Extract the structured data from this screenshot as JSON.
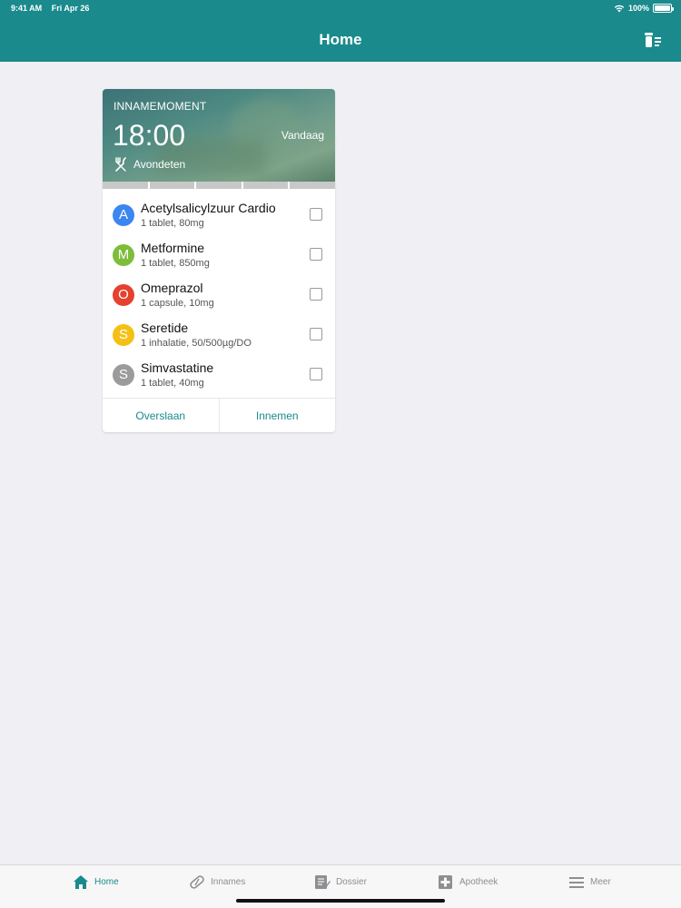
{
  "status_bar": {
    "time": "9:41 AM",
    "date": "Fri Apr 26",
    "battery": "100%"
  },
  "nav": {
    "title": "Home",
    "action_icon": "medicine-list-icon"
  },
  "card": {
    "moment_label": "INNAMEMOMENT",
    "time": "18:00",
    "day": "Vandaag",
    "meal": "Avondeten",
    "meal_icon": "fork-knife-icon",
    "medications": [
      {
        "initial": "A",
        "name": "Acetylsalicylzuur Cardio",
        "dose": "1 tablet, 80mg",
        "color": "#3b86f0",
        "checked": false
      },
      {
        "initial": "M",
        "name": "Metformine",
        "dose": "1 tablet, 850mg",
        "color": "#7cbd3a",
        "checked": false
      },
      {
        "initial": "O",
        "name": "Omeprazol",
        "dose": "1 capsule, 10mg",
        "color": "#e5412f",
        "checked": false
      },
      {
        "initial": "S",
        "name": "Seretide",
        "dose": "1 inhalatie, 50/500µg/DO",
        "color": "#f4c016",
        "checked": false
      },
      {
        "initial": "S",
        "name": "Simvastatine",
        "dose": "1 tablet, 40mg",
        "color": "#9b9b9b",
        "checked": false
      }
    ],
    "skip_label": "Overslaan",
    "take_label": "Innemen"
  },
  "tabbar": {
    "items": [
      {
        "label": "Home",
        "icon": "home-icon",
        "active": true
      },
      {
        "label": "Innames",
        "icon": "pill-icon",
        "active": false
      },
      {
        "label": "Dossier",
        "icon": "dossier-icon",
        "active": false
      },
      {
        "label": "Apotheek",
        "icon": "pharmacy-cross-icon",
        "active": false
      },
      {
        "label": "Meer",
        "icon": "menu-icon",
        "active": false
      }
    ]
  },
  "colors": {
    "brand": "#1a8a8c",
    "background": "#efeff4"
  }
}
